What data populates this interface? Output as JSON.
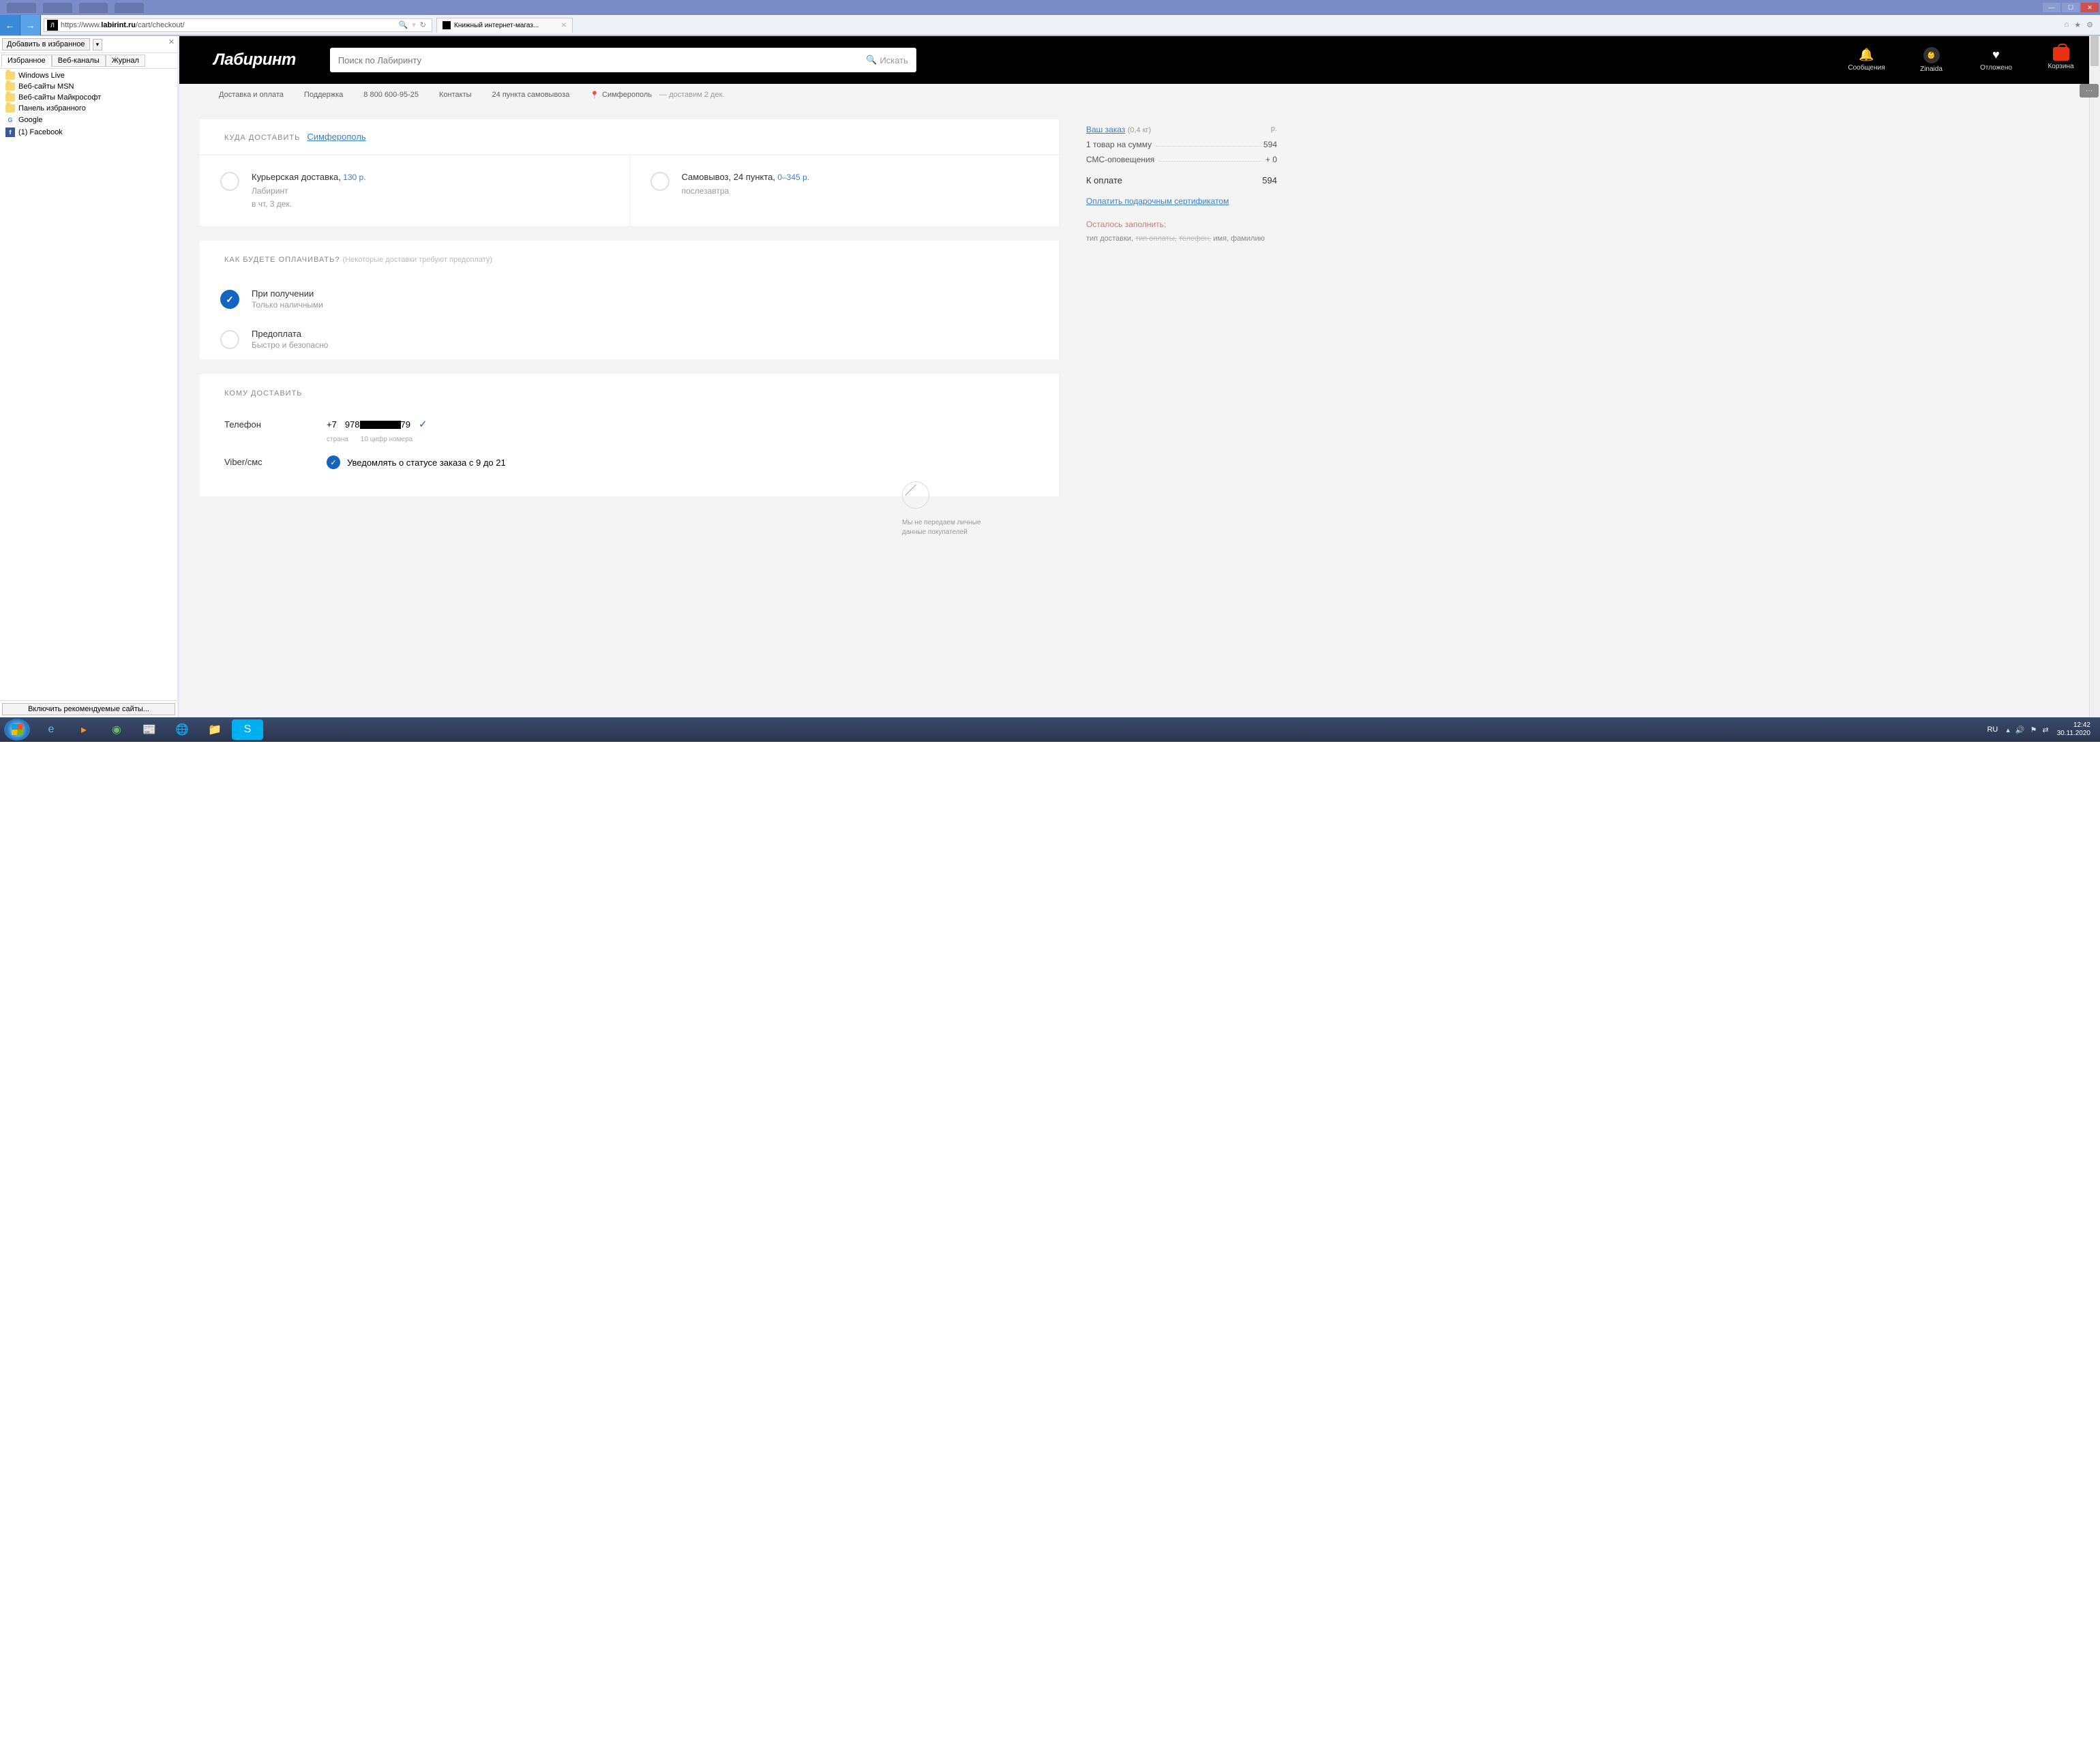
{
  "window": {
    "minimize": "—",
    "maximize": "☐",
    "close": "✕",
    "ghost_tabs": [
      "…",
      "…",
      "…"
    ]
  },
  "browser": {
    "back": "←",
    "forward": "→",
    "url_prefix": "https://www.",
    "url_host": "labirint.ru",
    "url_path": "/cart/checkout/",
    "search_glyph": "🔍",
    "refresh": "↻",
    "tab_title": "Книжный интернет-магаз...",
    "home": "⌂",
    "star": "★",
    "gear": "⚙"
  },
  "sidebar": {
    "add_fav": "Добавить в избранное",
    "tabs": {
      "fav": "Избранное",
      "feeds": "Веб-каналы",
      "journal": "Журнал"
    },
    "items": [
      {
        "label": "Windows Live",
        "type": "folder"
      },
      {
        "label": "Веб-сайты MSN",
        "type": "folder"
      },
      {
        "label": "Веб-сайты Майкрософт",
        "type": "folder"
      },
      {
        "label": "Панель избранного",
        "type": "folder"
      },
      {
        "label": "Google",
        "type": "google"
      },
      {
        "label": "(1) Facebook",
        "type": "fb"
      }
    ],
    "footer_btn": "Включить рекомендуемые сайты..."
  },
  "header": {
    "logo": "Лабиринт",
    "search_placeholder": "Поиск по Лабиринту",
    "search_btn": "Искать",
    "icons": {
      "messages": "Сообщения",
      "user": "Zinaida",
      "deferred": "Отложено",
      "cart": "Корзина"
    }
  },
  "subnav": {
    "delivery": "Доставка и оплата",
    "support": "Поддержка",
    "phone": "8 800 600-95-25",
    "contacts": "Контакты",
    "pickup": "24 пункта самовывоза",
    "city": "Симферополь",
    "eta": "— доставим 2 дек."
  },
  "section1": {
    "title": "КУДА ДОСТАВИТЬ",
    "city": "Симферополь"
  },
  "delivery_options": [
    {
      "title": "Курьерская доставка,",
      "price": "130 р.",
      "sub1": "Лабиринт",
      "sub2": "в чт, 3 дек."
    },
    {
      "title": "Самовывоз, 24 пункта,",
      "price": "0–345 р.",
      "sub1": "послезавтра",
      "sub2": ""
    }
  ],
  "payment": {
    "title": "КАК БУДЕТЕ ОПЛАЧИВАТЬ?",
    "hint": "(Некоторые доставки требуют предоплату)",
    "options": [
      {
        "title": "При получении",
        "sub": "Только наличными",
        "checked": true
      },
      {
        "title": "Предоплата",
        "sub": "Быстро и безопасно",
        "checked": false
      }
    ]
  },
  "recipient": {
    "title": "КОМУ ДОСТАВИТЬ",
    "phone_label": "Телефон",
    "country_code": "+7",
    "phone_part1": "978",
    "phone_part2": "79",
    "hint_country": "страна",
    "hint_digits": "10 цифр номера",
    "viber_label": "Viber/смс",
    "viber_text": "Уведомлять о статусе заказа с 9 до 21",
    "privacy": "Мы не передаем личные данные покупателей"
  },
  "order": {
    "your_order": "Ваш заказ",
    "weight": "(0,4 кг)",
    "currency": "р.",
    "line1_label": "1 товар на сумму",
    "line1_val": "594",
    "line2_label": "СМС-оповещения",
    "line2_val": "+ 0",
    "total_label": "К оплате",
    "total_val": "594",
    "gift_link": "Оплатить подарочным сертификатом",
    "todo_head": "Осталось заполнить:",
    "todo_delivery": "тип доставки,",
    "todo_payment": "тип оплаты,",
    "todo_phone": "телефон,",
    "todo_name": "имя, фамилию"
  },
  "taskbar": {
    "lang": "RU",
    "time": "12:42",
    "date": "30.11.2020"
  }
}
